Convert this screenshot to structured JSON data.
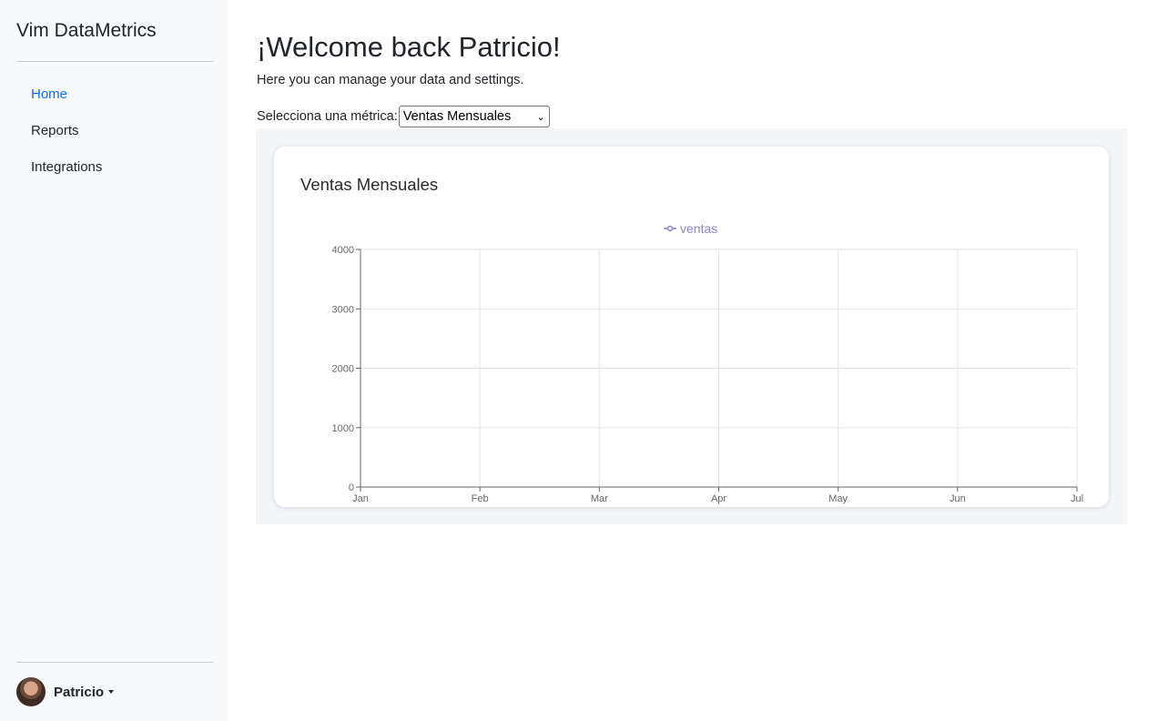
{
  "sidebar": {
    "brand": "Vim DataMetrics",
    "nav": [
      {
        "label": "Home",
        "active": true
      },
      {
        "label": "Reports",
        "active": false
      },
      {
        "label": "Integrations",
        "active": false
      }
    ],
    "user": {
      "name": "Patricio"
    }
  },
  "main": {
    "title": "¡Welcome back Patricio!",
    "subtitle": "Here you can manage your data and settings.",
    "selector_label": "Selecciona una métrica:",
    "selected_metric": "Ventas Mensuales"
  },
  "card": {
    "title": "Ventas Mensuales"
  },
  "colors": {
    "accent": "#0d6efd",
    "series": "#8884d8",
    "grid": "#e5e5e5",
    "axis": "#666666"
  },
  "chart_data": {
    "type": "line",
    "categories": [
      "Jan",
      "Feb",
      "Mar",
      "Apr",
      "May",
      "Jun",
      "Jul"
    ],
    "series": [
      {
        "name": "ventas",
        "values": []
      }
    ],
    "yticks": [
      0,
      1000,
      2000,
      3000,
      4000
    ],
    "ylim": [
      0,
      4000
    ],
    "grid": true,
    "legend": "top-center"
  }
}
